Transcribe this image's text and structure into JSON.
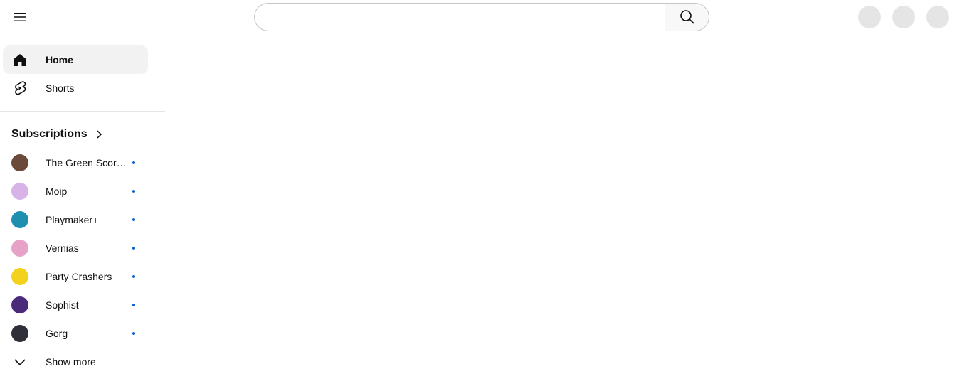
{
  "header": {
    "search": {
      "placeholder": "",
      "value": ""
    }
  },
  "sidebar": {
    "main_items": [
      {
        "label": "Home",
        "icon": "home-icon",
        "active": true
      },
      {
        "label": "Shorts",
        "icon": "shorts-icon",
        "active": false
      }
    ],
    "subscriptions": {
      "title": "Subscriptions",
      "channels": [
        {
          "name": "The Green Scorpion",
          "avatar_color": "#6b4a3a",
          "new": true
        },
        {
          "name": "Moip",
          "avatar_color": "#d7b3e8",
          "new": true
        },
        {
          "name": "Playmaker+",
          "avatar_color": "#1f8fb0",
          "new": true
        },
        {
          "name": "Vernias",
          "avatar_color": "#e7a3c7",
          "new": true
        },
        {
          "name": "Party Crashers",
          "avatar_color": "#f2d21c",
          "new": true
        },
        {
          "name": "Sophist",
          "avatar_color": "#4b2a7a",
          "new": true
        },
        {
          "name": "Gorg",
          "avatar_color": "#2f2f3a",
          "new": true
        }
      ],
      "show_more_label": "Show more"
    }
  },
  "colors": {
    "accent_dot": "#065fd4",
    "active_bg": "#f2f2f2"
  }
}
